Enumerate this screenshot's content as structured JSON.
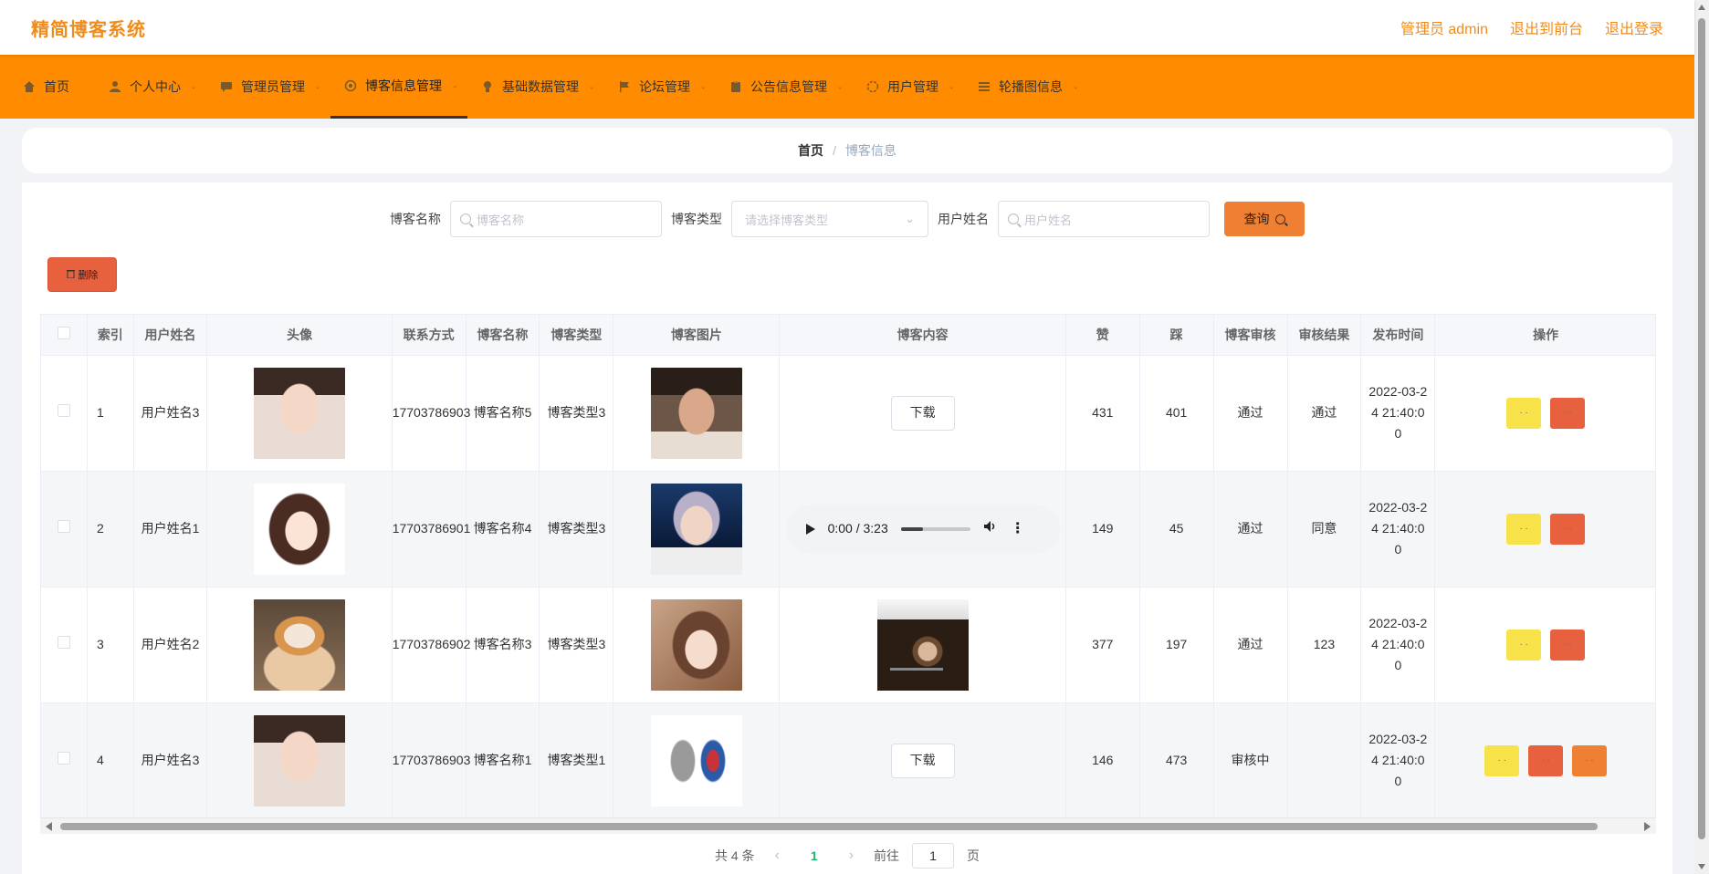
{
  "app": {
    "title": "精简博客系统"
  },
  "header_links": [
    "管理员 admin",
    "退出到前台",
    "退出登录"
  ],
  "nav": [
    {
      "label": "首页",
      "icon": "home-icon",
      "caret": false,
      "active": false
    },
    {
      "label": "个人中心",
      "icon": "user-icon",
      "caret": true,
      "active": false
    },
    {
      "label": "管理员管理",
      "icon": "chat-icon",
      "caret": true,
      "active": false
    },
    {
      "label": "博客信息管理",
      "icon": "gear-icon",
      "caret": true,
      "active": true
    },
    {
      "label": "基础数据管理",
      "icon": "lightbulb-icon",
      "caret": true,
      "active": false
    },
    {
      "label": "论坛管理",
      "icon": "flag-icon",
      "caret": true,
      "active": false
    },
    {
      "label": "公告信息管理",
      "icon": "clipboard-icon",
      "caret": true,
      "active": false
    },
    {
      "label": "用户管理",
      "icon": "circle-icon",
      "caret": true,
      "active": false
    },
    {
      "label": "轮播图信息",
      "icon": "list-icon",
      "caret": true,
      "active": false
    }
  ],
  "breadcrumb": {
    "home": "首页",
    "sep": "/",
    "current": "博客信息"
  },
  "search": {
    "name_label": "博客名称",
    "name_placeholder": "博客名称",
    "type_label": "博客类型",
    "type_placeholder": "请选择博客类型",
    "user_label": "用户姓名",
    "user_placeholder": "用户姓名",
    "query_label": "查询"
  },
  "delete_label": "删除",
  "table": {
    "headers": [
      "",
      "索引",
      "用户姓名",
      "头像",
      "联系方式",
      "博客名称",
      "博客类型",
      "博客图片",
      "博客内容",
      "赞",
      "踩",
      "博客审核",
      "审核结果",
      "发布时间",
      "操作"
    ],
    "rows": [
      {
        "index": "1",
        "user": "用户姓名3",
        "phone": "17703786903",
        "blog_name": "博客名称5",
        "blog_type": "博客类型3",
        "content": "下载",
        "likes": "431",
        "dislikes": "401",
        "review": "通过",
        "result": "通过",
        "time": "2022-03-24 21:40:00"
      },
      {
        "index": "2",
        "user": "用户姓名1",
        "phone": "17703786901",
        "blog_name": "博客名称4",
        "blog_type": "博客类型3",
        "content": "0:00 / 3:23",
        "likes": "149",
        "dislikes": "45",
        "review": "通过",
        "result": "同意",
        "time": "2022-03-24 21:40:00"
      },
      {
        "index": "3",
        "user": "用户姓名2",
        "phone": "17703786902",
        "blog_name": "博客名称3",
        "blog_type": "博客类型3",
        "content": "",
        "likes": "377",
        "dislikes": "197",
        "review": "通过",
        "result": "123",
        "time": "2022-03-24 21:40:00"
      },
      {
        "index": "4",
        "user": "用户姓名3",
        "phone": "17703786903",
        "blog_name": "博客名称1",
        "blog_type": "博客类型1",
        "content": "下载",
        "likes": "146",
        "dislikes": "473",
        "review": "审核中",
        "result": "",
        "time": "2022-03-24 21:40:00"
      }
    ]
  },
  "pagination": {
    "total": "共 4 条",
    "current": "1",
    "goto_label": "前往",
    "goto_value": "1",
    "page_suffix": "页"
  },
  "colors": {
    "nav_bg": "#ff8c00",
    "accent": "#f08c1c",
    "delete": "#e8613f",
    "edit": "#f7e24a",
    "query": "#ef7f32"
  }
}
